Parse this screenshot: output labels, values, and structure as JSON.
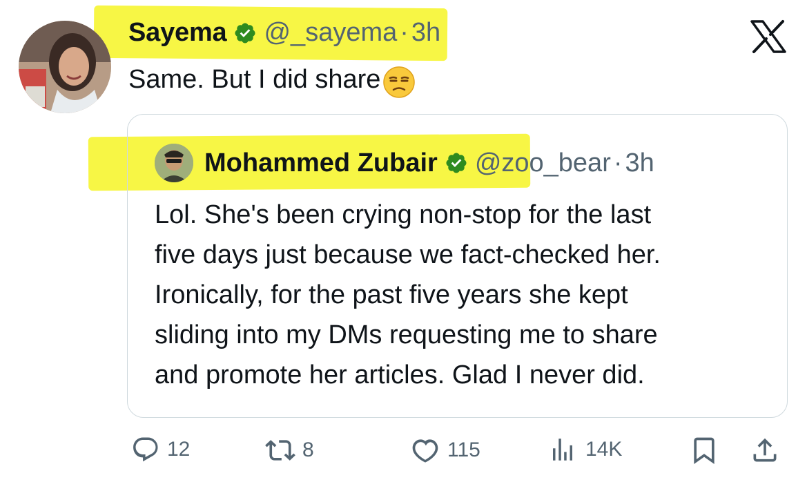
{
  "tweet": {
    "author": {
      "name": "Sayema",
      "handle": "@_sayema",
      "verified": true
    },
    "separator": "·",
    "time": "3h",
    "text": "Same. But I did share",
    "emoji": "unamused-face-emoji"
  },
  "quoted": {
    "author": {
      "name": "Mohammed Zubair",
      "handle": "@zoo_bear",
      "verified": true
    },
    "separator": "·",
    "time": "3h",
    "lines": [
      "Lol. She's been crying non-stop for the last",
      "five days just because we fact-checked her.",
      "Ironically, for the past five years she kept",
      "sliding into my DMs requesting me to share",
      "and promote her articles. Glad I never did."
    ]
  },
  "actions": {
    "replies": "12",
    "reposts": "8",
    "likes": "115",
    "views": "14K"
  },
  "colors": {
    "highlight": "#f6f535",
    "verified_badge": "#2e8b1f",
    "secondary_text": "#536471",
    "card_border": "#cfd9de"
  },
  "icons": {
    "close": "x-logo-icon",
    "reply": "reply-icon",
    "repost": "repost-icon",
    "like": "heart-icon",
    "views": "views-icon",
    "bookmark": "bookmark-icon",
    "share": "share-icon"
  }
}
